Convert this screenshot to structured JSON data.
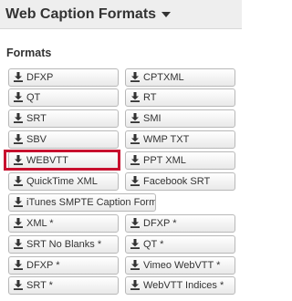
{
  "header": {
    "title": "Web Caption Formats"
  },
  "section": {
    "title": "Formats"
  },
  "buttons": [
    "DFXP",
    "CPTXML",
    "QT",
    "RT",
    "SRT",
    "SMI",
    "SBV",
    "WMP TXT",
    "WEBVTT",
    "PPT XML",
    "QuickTime XML",
    "Facebook SRT",
    "iTunes SMPTE Caption Format",
    "XML *",
    "DFXP *",
    "SRT No Blanks *",
    "QT *",
    "DFXP *",
    "Vimeo WebVTT *",
    "SRT *",
    "WebVTT Indices *"
  ],
  "highlighted_button": "WEBVTT",
  "colors": {
    "highlight": "#c8102e",
    "header_bg": "#eeeeee"
  }
}
